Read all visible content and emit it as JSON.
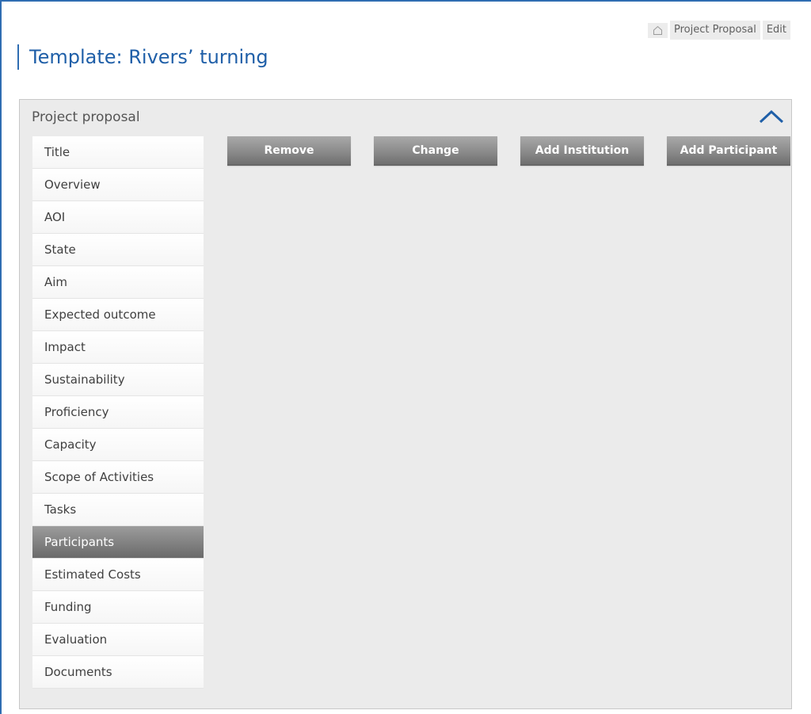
{
  "breadcrumb": {
    "home_icon": "home-icon",
    "items": [
      "Project Proposal",
      "Edit"
    ]
  },
  "page": {
    "title": "Template: Rivers’ turning"
  },
  "panel": {
    "title": "Project proposal",
    "collapse_icon": "chevron-up-icon"
  },
  "sidebar": {
    "items": [
      {
        "label": "Title"
      },
      {
        "label": "Overview"
      },
      {
        "label": "AOI"
      },
      {
        "label": "State"
      },
      {
        "label": "Aim"
      },
      {
        "label": "Expected outcome"
      },
      {
        "label": "Impact"
      },
      {
        "label": "Sustainability"
      },
      {
        "label": "Proficiency"
      },
      {
        "label": "Capacity"
      },
      {
        "label": "Scope of Activities"
      },
      {
        "label": "Tasks"
      },
      {
        "label": "Participants"
      },
      {
        "label": "Estimated Costs"
      },
      {
        "label": "Funding"
      },
      {
        "label": "Evaluation"
      },
      {
        "label": "Documents"
      }
    ],
    "active": "Participants"
  },
  "actions": {
    "remove": "Remove",
    "change": "Change",
    "add_institution": "Add Institution",
    "add_participant": "Add Participant"
  },
  "colors": {
    "accent": "#2f6db2",
    "title": "#1f5fa8",
    "panel_bg": "#ebebeb",
    "active_item": "#7a7a7a"
  }
}
